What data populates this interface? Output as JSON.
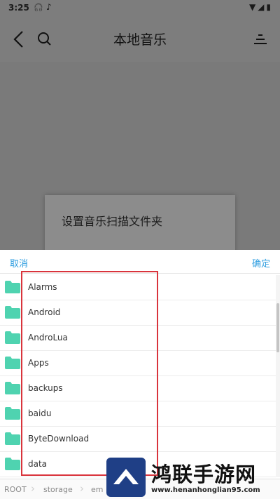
{
  "status_bar": {
    "time": "3:25",
    "icon_a": "headphones-icon",
    "icon_b": "tiktok-icon",
    "right_icons": "wifi-icon signal-icon battery-icon"
  },
  "app_bar": {
    "title": "本地音乐"
  },
  "background_dialog": {
    "title": "设置音乐扫描文件夹"
  },
  "sheet": {
    "cancel_label": "取消",
    "confirm_label": "确定",
    "folders": [
      {
        "name": "Alarms"
      },
      {
        "name": "Android"
      },
      {
        "name": "AndroLua"
      },
      {
        "name": "Apps"
      },
      {
        "name": "backups"
      },
      {
        "name": "baidu"
      },
      {
        "name": "ByteDownload"
      },
      {
        "name": "data"
      }
    ],
    "breadcrumb": [
      "ROOT",
      "storage",
      "em"
    ]
  },
  "colors": {
    "accent": "#2f9ee0",
    "folder": "#4fd3b0",
    "highlight": "#d9343c",
    "watermark_blue": "#1f3f86"
  },
  "watermark": {
    "title": "鸿联手游网",
    "url": "www.henanhonglian95.com"
  }
}
